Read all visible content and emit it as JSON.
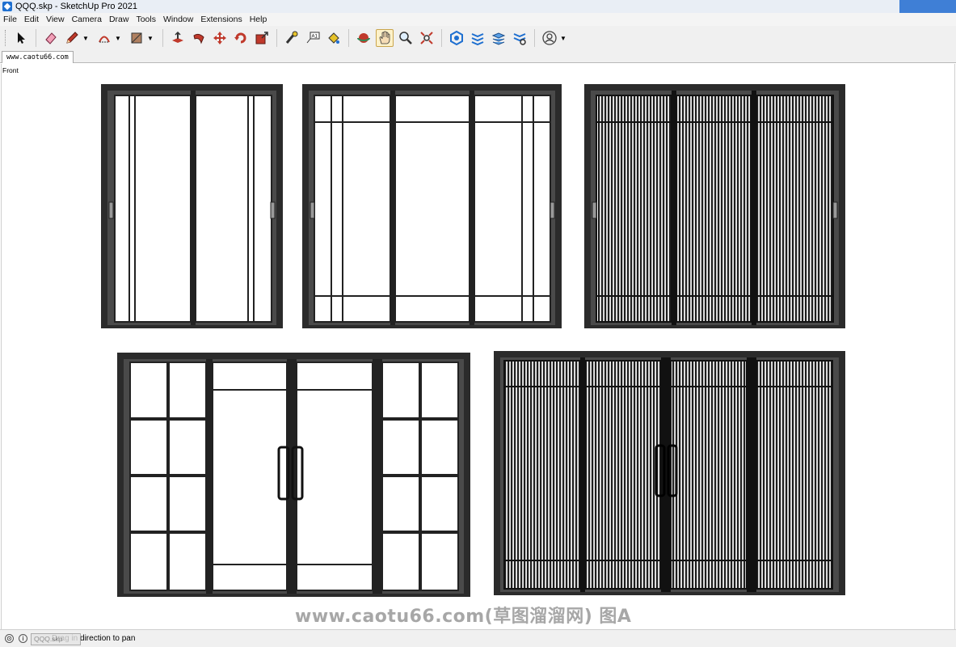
{
  "window": {
    "title": "QQQ.skp - SketchUp Pro 2021"
  },
  "menu": [
    "File",
    "Edit",
    "View",
    "Camera",
    "Draw",
    "Tools",
    "Window",
    "Extensions",
    "Help"
  ],
  "toolbar": {
    "tools": [
      {
        "name": "select-tool-icon"
      },
      {
        "name": "eraser-tool-icon"
      },
      {
        "name": "pencil-line-tool-icon",
        "dropdown": true
      },
      {
        "name": "arc-tool-icon",
        "dropdown": true
      },
      {
        "name": "rectangle-tool-icon",
        "dropdown": true
      },
      {
        "name": "push-pull-tool-icon"
      },
      {
        "name": "follow-me-tool-icon"
      },
      {
        "name": "move-tool-icon"
      },
      {
        "name": "rotate-tool-icon"
      },
      {
        "name": "scale-tool-icon"
      },
      {
        "name": "tape-measure-tool-icon"
      },
      {
        "name": "text-tool-icon"
      },
      {
        "name": "paint-bucket-tool-icon"
      },
      {
        "name": "orbit-tool-icon"
      },
      {
        "name": "pan-tool-icon",
        "active": true
      },
      {
        "name": "zoom-tool-icon"
      },
      {
        "name": "zoom-extents-tool-icon"
      },
      {
        "name": "3d-warehouse-icon"
      },
      {
        "name": "extension-warehouse-icon"
      },
      {
        "name": "layout-send-icon"
      },
      {
        "name": "extension-manager-icon"
      },
      {
        "name": "account-icon",
        "dropdown": true
      }
    ],
    "text_tool_glyph": "A1"
  },
  "scene_tab": "www.caotu66.com",
  "view_label": "Front",
  "watermark": "www.caotu66.com(草图溜溜网) 图A",
  "status": {
    "text": "Drag in direction to pan",
    "taskbar_chip": "QQQ.skp"
  },
  "colors": {
    "frame": "#2b2b2b",
    "accent_blue": "#1e6fd0",
    "active_tool": "#fdf1c9"
  }
}
